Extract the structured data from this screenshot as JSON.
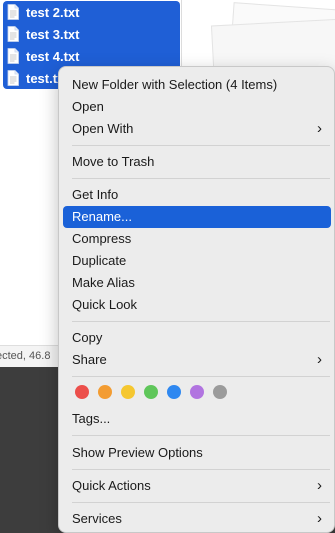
{
  "files": [
    {
      "name": "test 2.txt"
    },
    {
      "name": "test 3.txt"
    },
    {
      "name": "test 4.txt"
    },
    {
      "name": "test.txt"
    }
  ],
  "status_bar": {
    "text": "ected, 46.8"
  },
  "menu": {
    "new_folder": "New Folder with Selection (4 Items)",
    "open": "Open",
    "open_with": "Open With",
    "move_to_trash": "Move to Trash",
    "get_info": "Get Info",
    "rename": "Rename...",
    "compress": "Compress",
    "duplicate": "Duplicate",
    "make_alias": "Make Alias",
    "quick_look": "Quick Look",
    "copy": "Copy",
    "share": "Share",
    "tags": "Tags...",
    "show_preview_options": "Show Preview Options",
    "quick_actions": "Quick Actions",
    "services": "Services",
    "highlighted_item": "Rename..."
  },
  "tag_colors": [
    {
      "name": "red",
      "color": "#ec4f4b"
    },
    {
      "name": "orange",
      "color": "#f39c32"
    },
    {
      "name": "yellow",
      "color": "#f5c730"
    },
    {
      "name": "green",
      "color": "#5fc65a"
    },
    {
      "name": "blue",
      "color": "#2f88f0"
    },
    {
      "name": "purple",
      "color": "#b174e0"
    },
    {
      "name": "gray",
      "color": "#9b9b9b"
    }
  ],
  "colors": {
    "selection": "#1f5fd6",
    "menu_highlight": "#1a61d8",
    "menu_background": "#ececec"
  }
}
